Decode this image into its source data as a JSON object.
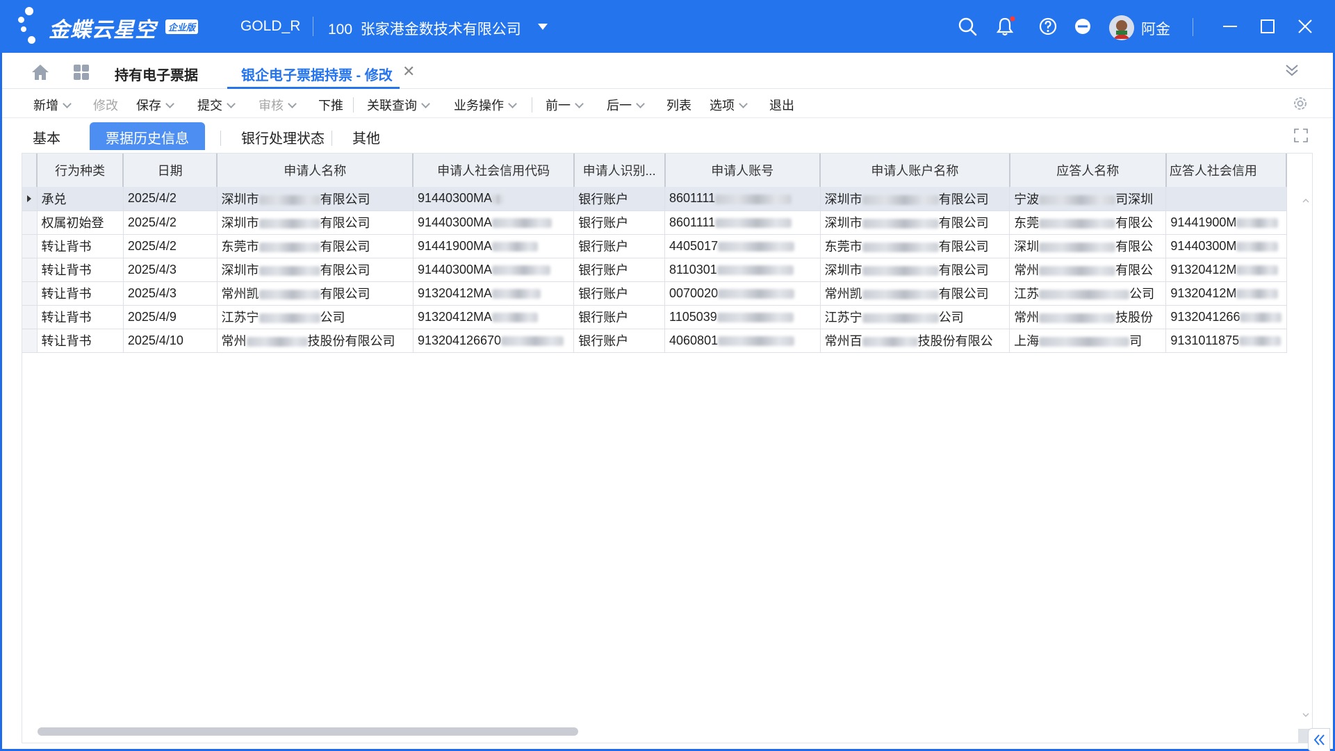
{
  "app": {
    "brand": "金蝶云星空",
    "edition": "企业版",
    "database": "GOLD_R",
    "org_code": "100",
    "org_name": "张家港金数技术有限公司",
    "user_name": "阿金",
    "accent_color": "#2474ee"
  },
  "icons": [
    "search-icon",
    "bell-icon",
    "help-icon",
    "minus-circle-icon",
    "minimize-icon",
    "maximize-icon",
    "close-icon",
    "home-icon",
    "apps-icon",
    "settings-icon",
    "expand-icon"
  ],
  "page_tabs": {
    "held": "持有电子票据",
    "edit": "银企电子票据持票 - 修改"
  },
  "toolbar": {
    "new": "新增",
    "modify": "修改",
    "save": "保存",
    "submit": "提交",
    "audit": "审核",
    "push": "下推",
    "related_query": "关联查询",
    "business_ops": "业务操作",
    "prev": "前一",
    "next": "后一",
    "list": "列表",
    "options": "选项",
    "exit": "退出"
  },
  "subtabs": [
    "基本",
    "票据历史信息",
    "银行处理状态",
    "其他"
  ],
  "grid": {
    "columns": [
      "行为种类",
      "日期",
      "申请人名称",
      "申请人社会信用代码",
      "申请人识别...",
      "申请人账号",
      "申请人账户名称",
      "应答人名称",
      "应答人社会信用"
    ],
    "rows": [
      [
        "承兑",
        "2025/4/2",
        "深圳市",
        "有限公司",
        "91440300MA",
        "银行账户",
        "8601111",
        "深圳市",
        "有限公司",
        "宁波",
        "司深圳",
        ""
      ],
      [
        "权属初始登",
        "2025/4/2",
        "深圳市",
        "有限公司",
        "91440300MA",
        "银行账户",
        "8601111",
        "深圳市",
        "有限公司",
        "东莞",
        "有限公",
        "91441900M"
      ],
      [
        "转让背书",
        "2025/4/2",
        "东莞市",
        "有限公司",
        "91441900MA",
        "银行账户",
        "4405017",
        "东莞市",
        "有限公司",
        "深圳",
        "有限公",
        "91440300M"
      ],
      [
        "转让背书",
        "2025/4/3",
        "深圳市",
        "有限公司",
        "91440300MA",
        "银行账户",
        "8110301",
        "深圳市",
        "有限公司",
        "常州",
        "有限公",
        "91320412M"
      ],
      [
        "转让背书",
        "2025/4/3",
        "常州凯",
        "有限公司",
        "91320412MA",
        "银行账户",
        "0070020",
        "常州凯",
        "有限公司",
        "江苏",
        "公司",
        "91320412M"
      ],
      [
        "转让背书",
        "2025/4/9",
        "江苏宁",
        "公司",
        "91320412MA",
        "银行账户",
        "1105039",
        "江苏宁",
        "公司",
        "常州",
        "技股份",
        "9132041266"
      ],
      [
        "转让背书",
        "2025/4/10",
        "常州",
        "技股份有限公司",
        "913204126670",
        "银行账户",
        "4060801",
        "常州百",
        "技股份有限公",
        "上海",
        "司",
        "9131011875"
      ]
    ]
  }
}
